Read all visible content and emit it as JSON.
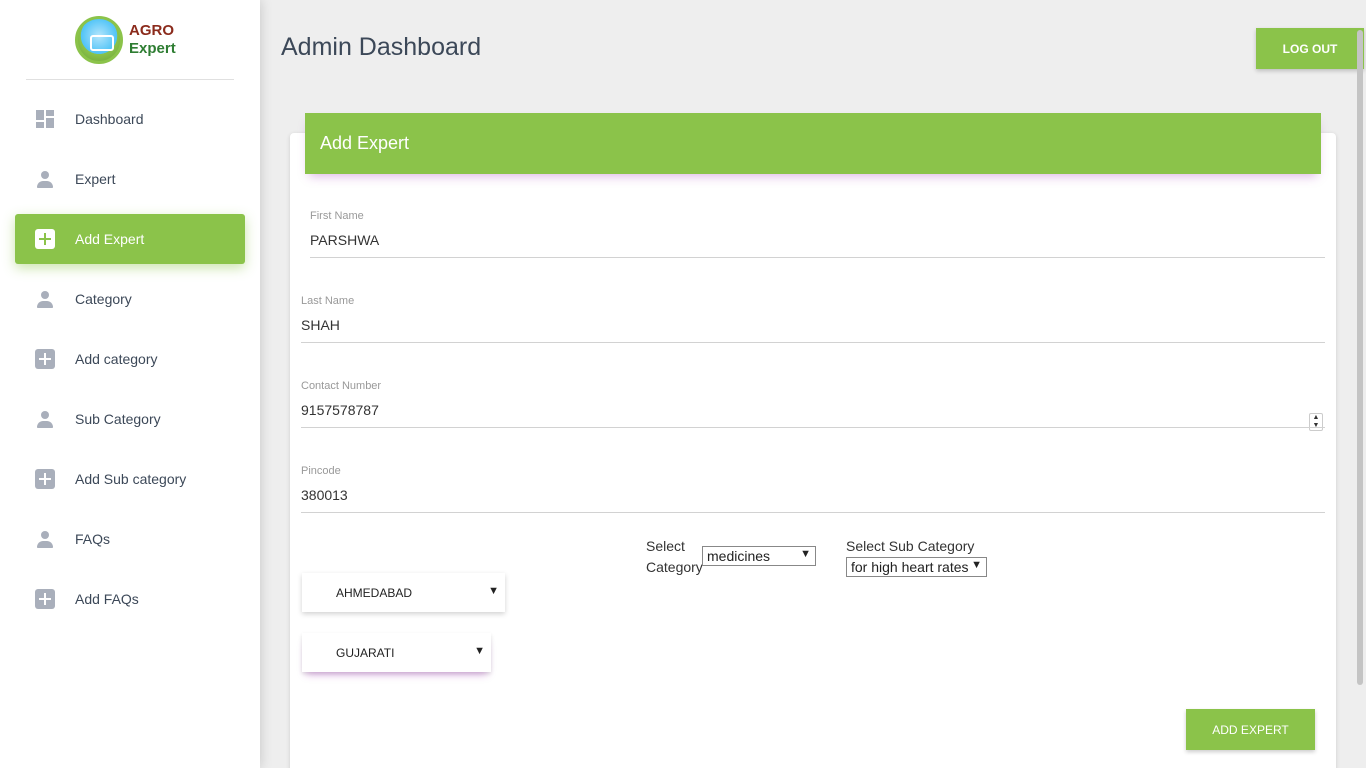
{
  "app": {
    "logo_line1": "AGRO",
    "logo_line2": "Expert",
    "page_title": "Admin Dashboard",
    "logout_label": "LOG OUT",
    "accent_color": "#8bc34a"
  },
  "sidebar": {
    "items": [
      {
        "label": "Dashboard",
        "icon": "dashboard-icon",
        "active": false
      },
      {
        "label": "Expert",
        "icon": "person-icon",
        "active": false
      },
      {
        "label": "Add Expert",
        "icon": "add-box-icon",
        "active": true
      },
      {
        "label": "Category",
        "icon": "person-icon",
        "active": false
      },
      {
        "label": "Add category",
        "icon": "add-box-icon",
        "active": false
      },
      {
        "label": "Sub Category",
        "icon": "person-icon",
        "active": false
      },
      {
        "label": "Add Sub category",
        "icon": "add-box-icon",
        "active": false
      },
      {
        "label": "FAQs",
        "icon": "person-icon",
        "active": false
      },
      {
        "label": "Add FAQs",
        "icon": "add-box-icon",
        "active": false
      }
    ]
  },
  "form": {
    "title": "Add Expert",
    "first_name": {
      "label": "First Name",
      "value": "PARSHWA"
    },
    "last_name": {
      "label": "Last Name",
      "value": "SHAH"
    },
    "contact": {
      "label": "Contact Number",
      "value": "9157578787"
    },
    "pincode": {
      "label": "Pincode",
      "value": "380013"
    },
    "category": {
      "label_line1": "Select",
      "label_line2": "Category",
      "selected": "medicines"
    },
    "sub_category": {
      "label": "Select Sub Category",
      "selected": "for high heart rates"
    },
    "city": {
      "selected": "AHMEDABAD"
    },
    "language": {
      "selected": "GUJARATI"
    },
    "submit_label": "ADD EXPERT"
  }
}
